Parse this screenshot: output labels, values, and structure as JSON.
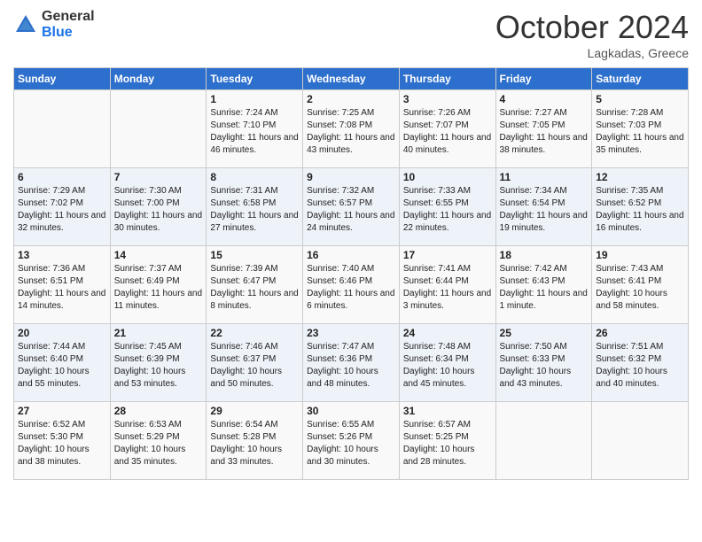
{
  "logo": {
    "general": "General",
    "blue": "Blue"
  },
  "title": "October 2024",
  "location": "Lagkadas, Greece",
  "headers": [
    "Sunday",
    "Monday",
    "Tuesday",
    "Wednesday",
    "Thursday",
    "Friday",
    "Saturday"
  ],
  "weeks": [
    [
      {
        "day": "",
        "sunrise": "",
        "sunset": "",
        "daylight": ""
      },
      {
        "day": "",
        "sunrise": "",
        "sunset": "",
        "daylight": ""
      },
      {
        "day": "1",
        "sunrise": "Sunrise: 7:24 AM",
        "sunset": "Sunset: 7:10 PM",
        "daylight": "Daylight: 11 hours and 46 minutes."
      },
      {
        "day": "2",
        "sunrise": "Sunrise: 7:25 AM",
        "sunset": "Sunset: 7:08 PM",
        "daylight": "Daylight: 11 hours and 43 minutes."
      },
      {
        "day": "3",
        "sunrise": "Sunrise: 7:26 AM",
        "sunset": "Sunset: 7:07 PM",
        "daylight": "Daylight: 11 hours and 40 minutes."
      },
      {
        "day": "4",
        "sunrise": "Sunrise: 7:27 AM",
        "sunset": "Sunset: 7:05 PM",
        "daylight": "Daylight: 11 hours and 38 minutes."
      },
      {
        "day": "5",
        "sunrise": "Sunrise: 7:28 AM",
        "sunset": "Sunset: 7:03 PM",
        "daylight": "Daylight: 11 hours and 35 minutes."
      }
    ],
    [
      {
        "day": "6",
        "sunrise": "Sunrise: 7:29 AM",
        "sunset": "Sunset: 7:02 PM",
        "daylight": "Daylight: 11 hours and 32 minutes."
      },
      {
        "day": "7",
        "sunrise": "Sunrise: 7:30 AM",
        "sunset": "Sunset: 7:00 PM",
        "daylight": "Daylight: 11 hours and 30 minutes."
      },
      {
        "day": "8",
        "sunrise": "Sunrise: 7:31 AM",
        "sunset": "Sunset: 6:58 PM",
        "daylight": "Daylight: 11 hours and 27 minutes."
      },
      {
        "day": "9",
        "sunrise": "Sunrise: 7:32 AM",
        "sunset": "Sunset: 6:57 PM",
        "daylight": "Daylight: 11 hours and 24 minutes."
      },
      {
        "day": "10",
        "sunrise": "Sunrise: 7:33 AM",
        "sunset": "Sunset: 6:55 PM",
        "daylight": "Daylight: 11 hours and 22 minutes."
      },
      {
        "day": "11",
        "sunrise": "Sunrise: 7:34 AM",
        "sunset": "Sunset: 6:54 PM",
        "daylight": "Daylight: 11 hours and 19 minutes."
      },
      {
        "day": "12",
        "sunrise": "Sunrise: 7:35 AM",
        "sunset": "Sunset: 6:52 PM",
        "daylight": "Daylight: 11 hours and 16 minutes."
      }
    ],
    [
      {
        "day": "13",
        "sunrise": "Sunrise: 7:36 AM",
        "sunset": "Sunset: 6:51 PM",
        "daylight": "Daylight: 11 hours and 14 minutes."
      },
      {
        "day": "14",
        "sunrise": "Sunrise: 7:37 AM",
        "sunset": "Sunset: 6:49 PM",
        "daylight": "Daylight: 11 hours and 11 minutes."
      },
      {
        "day": "15",
        "sunrise": "Sunrise: 7:39 AM",
        "sunset": "Sunset: 6:47 PM",
        "daylight": "Daylight: 11 hours and 8 minutes."
      },
      {
        "day": "16",
        "sunrise": "Sunrise: 7:40 AM",
        "sunset": "Sunset: 6:46 PM",
        "daylight": "Daylight: 11 hours and 6 minutes."
      },
      {
        "day": "17",
        "sunrise": "Sunrise: 7:41 AM",
        "sunset": "Sunset: 6:44 PM",
        "daylight": "Daylight: 11 hours and 3 minutes."
      },
      {
        "day": "18",
        "sunrise": "Sunrise: 7:42 AM",
        "sunset": "Sunset: 6:43 PM",
        "daylight": "Daylight: 11 hours and 1 minute."
      },
      {
        "day": "19",
        "sunrise": "Sunrise: 7:43 AM",
        "sunset": "Sunset: 6:41 PM",
        "daylight": "Daylight: 10 hours and 58 minutes."
      }
    ],
    [
      {
        "day": "20",
        "sunrise": "Sunrise: 7:44 AM",
        "sunset": "Sunset: 6:40 PM",
        "daylight": "Daylight: 10 hours and 55 minutes."
      },
      {
        "day": "21",
        "sunrise": "Sunrise: 7:45 AM",
        "sunset": "Sunset: 6:39 PM",
        "daylight": "Daylight: 10 hours and 53 minutes."
      },
      {
        "day": "22",
        "sunrise": "Sunrise: 7:46 AM",
        "sunset": "Sunset: 6:37 PM",
        "daylight": "Daylight: 10 hours and 50 minutes."
      },
      {
        "day": "23",
        "sunrise": "Sunrise: 7:47 AM",
        "sunset": "Sunset: 6:36 PM",
        "daylight": "Daylight: 10 hours and 48 minutes."
      },
      {
        "day": "24",
        "sunrise": "Sunrise: 7:48 AM",
        "sunset": "Sunset: 6:34 PM",
        "daylight": "Daylight: 10 hours and 45 minutes."
      },
      {
        "day": "25",
        "sunrise": "Sunrise: 7:50 AM",
        "sunset": "Sunset: 6:33 PM",
        "daylight": "Daylight: 10 hours and 43 minutes."
      },
      {
        "day": "26",
        "sunrise": "Sunrise: 7:51 AM",
        "sunset": "Sunset: 6:32 PM",
        "daylight": "Daylight: 10 hours and 40 minutes."
      }
    ],
    [
      {
        "day": "27",
        "sunrise": "Sunrise: 6:52 AM",
        "sunset": "Sunset: 5:30 PM",
        "daylight": "Daylight: 10 hours and 38 minutes."
      },
      {
        "day": "28",
        "sunrise": "Sunrise: 6:53 AM",
        "sunset": "Sunset: 5:29 PM",
        "daylight": "Daylight: 10 hours and 35 minutes."
      },
      {
        "day": "29",
        "sunrise": "Sunrise: 6:54 AM",
        "sunset": "Sunset: 5:28 PM",
        "daylight": "Daylight: 10 hours and 33 minutes."
      },
      {
        "day": "30",
        "sunrise": "Sunrise: 6:55 AM",
        "sunset": "Sunset: 5:26 PM",
        "daylight": "Daylight: 10 hours and 30 minutes."
      },
      {
        "day": "31",
        "sunrise": "Sunrise: 6:57 AM",
        "sunset": "Sunset: 5:25 PM",
        "daylight": "Daylight: 10 hours and 28 minutes."
      },
      {
        "day": "",
        "sunrise": "",
        "sunset": "",
        "daylight": ""
      },
      {
        "day": "",
        "sunrise": "",
        "sunset": "",
        "daylight": ""
      }
    ]
  ]
}
